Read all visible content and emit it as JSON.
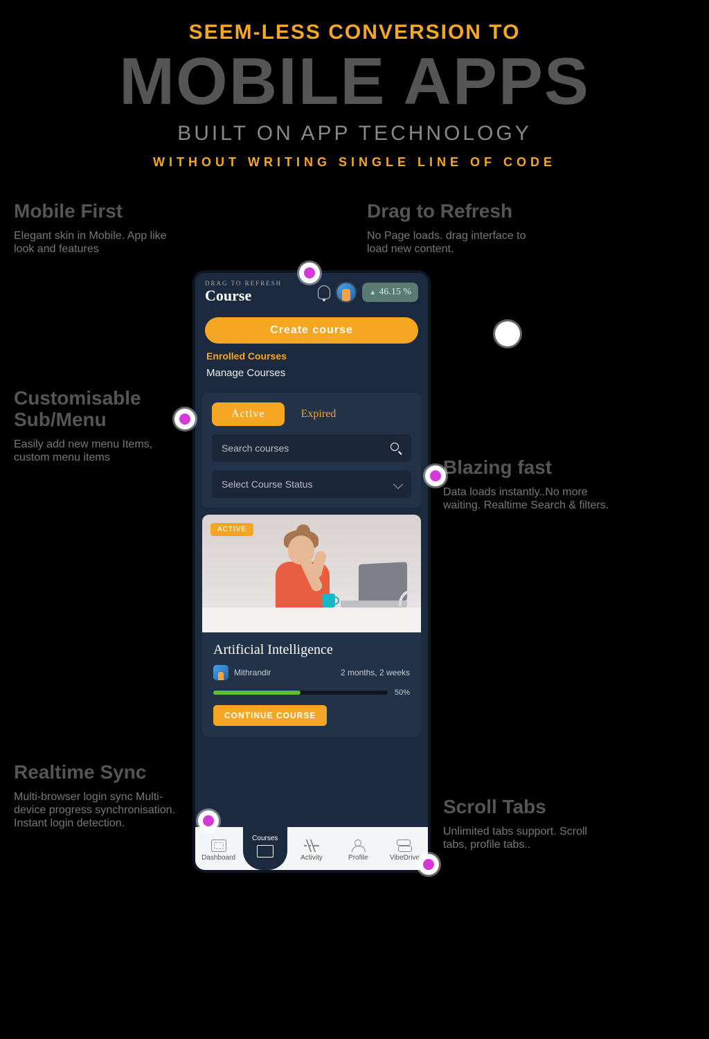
{
  "hero": {
    "line1": "SEEM-LESS  CONVERSION TO",
    "line2": "MOBILE APPS",
    "line3": "BUILT ON APP  TECHNOLOGY",
    "line4": "WITHOUT WRITING SINGLE LINE OF CODE"
  },
  "callouts": {
    "mobile_first": {
      "title": "Mobile First",
      "body": "Elegant skin in Mobile. App like look and features"
    },
    "drag_refresh": {
      "title": "Drag to Refresh",
      "body": "No Page loads. drag interface to load new content."
    },
    "custom_menu": {
      "title": "Customisable Sub/Menu",
      "body": "Easily add new menu Items, custom menu items"
    },
    "blazing": {
      "title": "Blazing fast",
      "body": "Data loads instantly..No more waiting. Realtime Search & filters."
    },
    "realtime": {
      "title": "Realtime Sync",
      "body": "Multi-browser login sync Multi-device progress synchronisation. Instant login detection."
    },
    "scrolltabs": {
      "title": "Scroll Tabs",
      "body": "Unlimited tabs support. Scroll tabs, profile tabs.."
    }
  },
  "phone": {
    "drag_label": "DRAG TO REFRESH",
    "title": "Course",
    "completion_pct": "46.15 %",
    "create_button": "Create course",
    "section_label": "Enrolled Courses",
    "menu_item": "Manage Courses",
    "tabs": {
      "active": "Active",
      "expired": "Expired"
    },
    "search_placeholder": "Search courses",
    "select_placeholder": "Select Course Status",
    "course": {
      "badge": "ACTIVE",
      "title": "Artificial Intelligence",
      "author": "Mithrandir",
      "age": "2 months, 2 weeks",
      "progress_pct": 50,
      "progress_label": "50%",
      "continue": "CONTINUE COURSE"
    },
    "nav": {
      "dashboard": "Dashboard",
      "courses": "Courses",
      "activity": "Activity",
      "profile": "Profile",
      "vibedrive": "VibeDrive"
    }
  }
}
